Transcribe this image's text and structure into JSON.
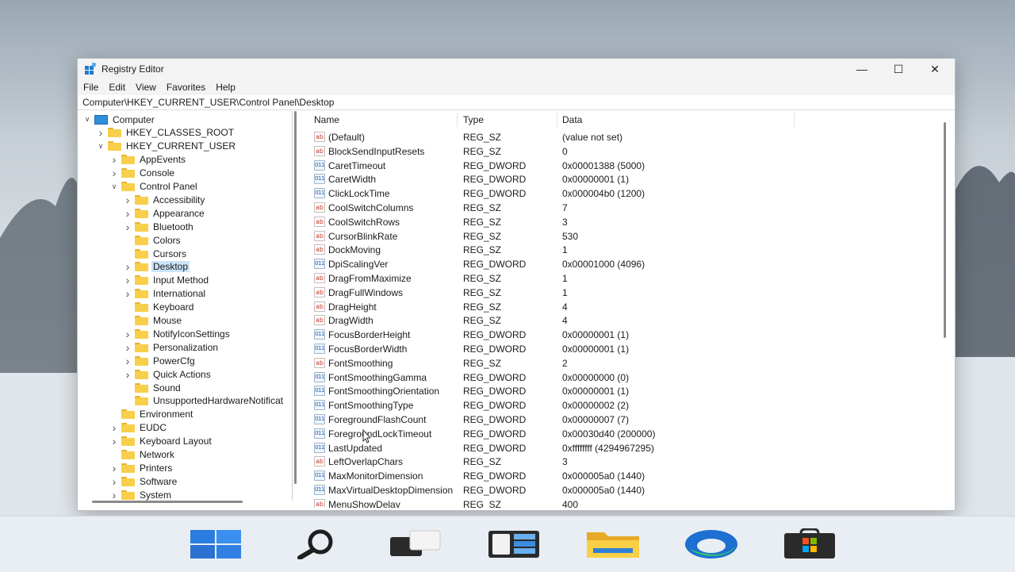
{
  "window": {
    "title": "Registry Editor",
    "caption": {
      "minimize": "—",
      "maximize": "☐",
      "close": "✕"
    }
  },
  "menu": [
    "File",
    "Edit",
    "View",
    "Favorites",
    "Help"
  ],
  "address": "Computer\\HKEY_CURRENT_USER\\Control Panel\\Desktop",
  "tree": [
    {
      "label": "Computer",
      "level": 0,
      "expand": "open",
      "icon": "computer-icon"
    },
    {
      "label": "HKEY_CLASSES_ROOT",
      "level": 1,
      "expand": "closed"
    },
    {
      "label": "HKEY_CURRENT_USER",
      "level": 1,
      "expand": "open"
    },
    {
      "label": "AppEvents",
      "level": 2,
      "expand": "closed"
    },
    {
      "label": "Console",
      "level": 2,
      "expand": "closed"
    },
    {
      "label": "Control Panel",
      "level": 2,
      "expand": "open"
    },
    {
      "label": "Accessibility",
      "level": 3,
      "expand": "closed"
    },
    {
      "label": "Appearance",
      "level": 3,
      "expand": "closed"
    },
    {
      "label": "Bluetooth",
      "level": 3,
      "expand": "closed"
    },
    {
      "label": "Colors",
      "level": 3,
      "expand": "none"
    },
    {
      "label": "Cursors",
      "level": 3,
      "expand": "none"
    },
    {
      "label": "Desktop",
      "level": 3,
      "expand": "closed",
      "selected": true
    },
    {
      "label": "Input Method",
      "level": 3,
      "expand": "closed"
    },
    {
      "label": "International",
      "level": 3,
      "expand": "closed"
    },
    {
      "label": "Keyboard",
      "level": 3,
      "expand": "none"
    },
    {
      "label": "Mouse",
      "level": 3,
      "expand": "none"
    },
    {
      "label": "NotifyIconSettings",
      "level": 3,
      "expand": "closed"
    },
    {
      "label": "Personalization",
      "level": 3,
      "expand": "closed"
    },
    {
      "label": "PowerCfg",
      "level": 3,
      "expand": "closed"
    },
    {
      "label": "Quick Actions",
      "level": 3,
      "expand": "closed"
    },
    {
      "label": "Sound",
      "level": 3,
      "expand": "none"
    },
    {
      "label": "UnsupportedHardwareNotificat",
      "level": 3,
      "expand": "none"
    },
    {
      "label": "Environment",
      "level": 2,
      "expand": "none"
    },
    {
      "label": "EUDC",
      "level": 2,
      "expand": "closed"
    },
    {
      "label": "Keyboard Layout",
      "level": 2,
      "expand": "closed"
    },
    {
      "label": "Network",
      "level": 2,
      "expand": "none"
    },
    {
      "label": "Printers",
      "level": 2,
      "expand": "closed"
    },
    {
      "label": "Software",
      "level": 2,
      "expand": "closed"
    },
    {
      "label": "System",
      "level": 2,
      "expand": "closed"
    }
  ],
  "columns": {
    "name": "Name",
    "type": "Type",
    "data": "Data"
  },
  "values": [
    {
      "name": "(Default)",
      "type": "REG_SZ",
      "data": "(value not set)"
    },
    {
      "name": "BlockSendInputResets",
      "type": "REG_SZ",
      "data": "0"
    },
    {
      "name": "CaretTimeout",
      "type": "REG_DWORD",
      "data": "0x00001388 (5000)"
    },
    {
      "name": "CaretWidth",
      "type": "REG_DWORD",
      "data": "0x00000001 (1)"
    },
    {
      "name": "ClickLockTime",
      "type": "REG_DWORD",
      "data": "0x000004b0 (1200)"
    },
    {
      "name": "CoolSwitchColumns",
      "type": "REG_SZ",
      "data": "7"
    },
    {
      "name": "CoolSwitchRows",
      "type": "REG_SZ",
      "data": "3"
    },
    {
      "name": "CursorBlinkRate",
      "type": "REG_SZ",
      "data": "530"
    },
    {
      "name": "DockMoving",
      "type": "REG_SZ",
      "data": "1"
    },
    {
      "name": "DpiScalingVer",
      "type": "REG_DWORD",
      "data": "0x00001000 (4096)"
    },
    {
      "name": "DragFromMaximize",
      "type": "REG_SZ",
      "data": "1"
    },
    {
      "name": "DragFullWindows",
      "type": "REG_SZ",
      "data": "1"
    },
    {
      "name": "DragHeight",
      "type": "REG_SZ",
      "data": "4"
    },
    {
      "name": "DragWidth",
      "type": "REG_SZ",
      "data": "4"
    },
    {
      "name": "FocusBorderHeight",
      "type": "REG_DWORD",
      "data": "0x00000001 (1)"
    },
    {
      "name": "FocusBorderWidth",
      "type": "REG_DWORD",
      "data": "0x00000001 (1)"
    },
    {
      "name": "FontSmoothing",
      "type": "REG_SZ",
      "data": "2"
    },
    {
      "name": "FontSmoothingGamma",
      "type": "REG_DWORD",
      "data": "0x00000000 (0)"
    },
    {
      "name": "FontSmoothingOrientation",
      "type": "REG_DWORD",
      "data": "0x00000001 (1)"
    },
    {
      "name": "FontSmoothingType",
      "type": "REG_DWORD",
      "data": "0x00000002 (2)"
    },
    {
      "name": "ForegroundFlashCount",
      "type": "REG_DWORD",
      "data": "0x00000007 (7)"
    },
    {
      "name": "ForegroundLockTimeout",
      "type": "REG_DWORD",
      "data": "0x00030d40 (200000)"
    },
    {
      "name": "LastUpdated",
      "type": "REG_DWORD",
      "data": "0xffffffff (4294967295)"
    },
    {
      "name": "LeftOverlapChars",
      "type": "REG_SZ",
      "data": "3"
    },
    {
      "name": "MaxMonitorDimension",
      "type": "REG_DWORD",
      "data": "0x000005a0 (1440)"
    },
    {
      "name": "MaxVirtualDesktopDimension",
      "type": "REG_DWORD",
      "data": "0x000005a0 (1440)"
    },
    {
      "name": "MenuShowDelay",
      "type": "REG_SZ",
      "data": "400"
    }
  ],
  "value_icons": {
    "REG_SZ": "ab",
    "REG_DWORD": "011"
  },
  "taskbar": [
    "start-icon",
    "search-icon",
    "task-view-icon",
    "widgets-icon",
    "file-explorer-icon",
    "edge-icon",
    "store-icon"
  ]
}
